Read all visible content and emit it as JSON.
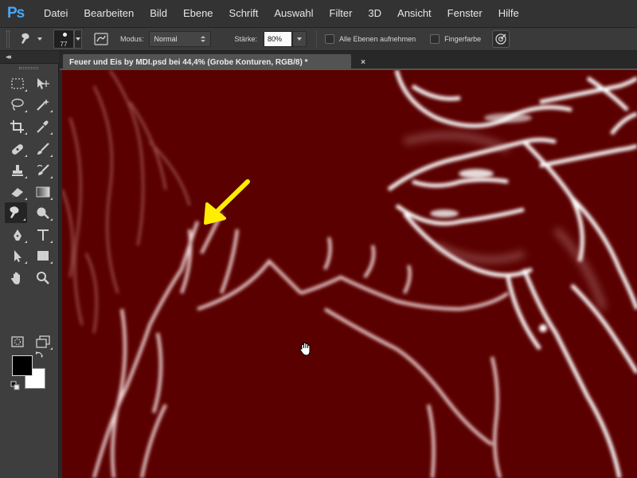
{
  "app": {
    "logo": "Ps"
  },
  "menu": [
    "Datei",
    "Bearbeiten",
    "Bild",
    "Ebene",
    "Schrift",
    "Auswahl",
    "Filter",
    "3D",
    "Ansicht",
    "Fenster",
    "Hilfe"
  ],
  "options": {
    "brush_size": "77",
    "mode_label": "Modus:",
    "mode_value": "Normal",
    "strength_label": "Stärke:",
    "strength_value": "80%",
    "sample_all_layers": "Alle Ebenen aufnehmen",
    "finger_painting": "Fingerfarbe"
  },
  "document": {
    "tab_title": "Feuer und Eis by MDI.psd bei 44,4% (Grobe Konturen, RGB/8) *",
    "close": "×"
  },
  "toolbox": {
    "active_tool": "smudge-tool",
    "tool_icons": [
      "marquee",
      "move",
      "lasso",
      "magic-wand",
      "crop",
      "eyedropper",
      "healing-brush",
      "brush",
      "clone-stamp",
      "history-brush",
      "eraser",
      "gradient",
      "smudge",
      "dodge",
      "pen",
      "type",
      "path-selection",
      "rectangle",
      "hand",
      "zoom",
      "quick-mask",
      "screen-mode"
    ],
    "foreground_color": "#000000",
    "background_color": "#ffffff"
  },
  "canvas": {
    "background_color": "#5b0000",
    "annotation": "yellow-arrow",
    "cursor": "hand-cursor"
  },
  "colors": {
    "accent": "#47a6ff",
    "arrow": "#ffee00",
    "canvas": "#5b0000"
  }
}
